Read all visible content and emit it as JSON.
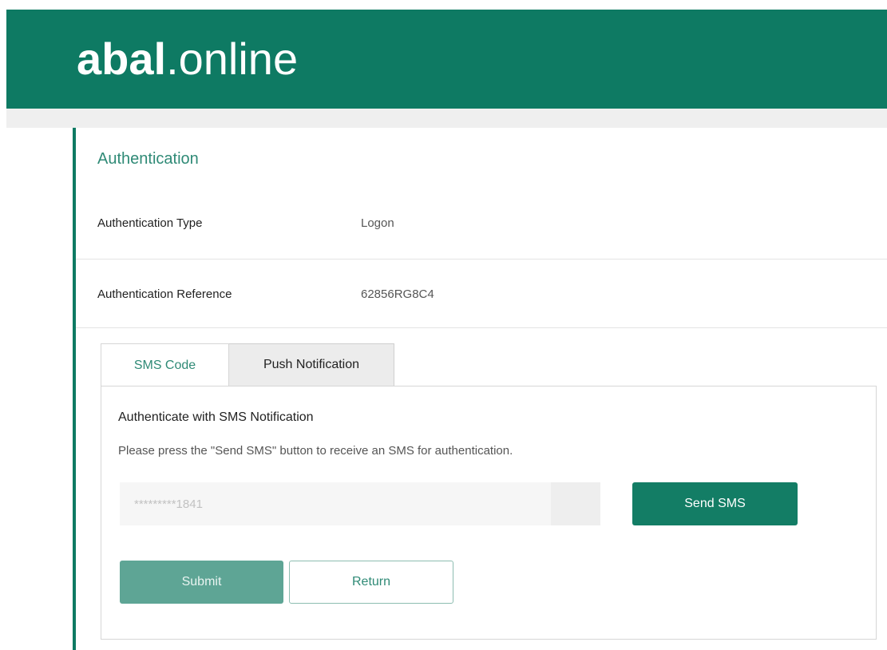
{
  "header": {
    "logo_bold": "abal",
    "logo_light": ".online"
  },
  "auth": {
    "title": "Authentication",
    "type_label": "Authentication Type",
    "type_value": "Logon",
    "reference_label": "Authentication Reference",
    "reference_value": "62856RG8C4"
  },
  "tabs": [
    {
      "label": "SMS Code",
      "active": true
    },
    {
      "label": "Push Notification",
      "active": false
    }
  ],
  "sms": {
    "title": "Authenticate with SMS Notification",
    "description": "Please press the \"Send SMS\" button to receive an SMS for authentication.",
    "phone_value": "*********1841",
    "send_label": "Send SMS"
  },
  "actions": {
    "submit_label": "Submit",
    "return_label": "Return"
  },
  "colors": {
    "brand": "#0e7a63",
    "accent_text": "#2f8a76",
    "submit_disabled": "#5ea595"
  }
}
